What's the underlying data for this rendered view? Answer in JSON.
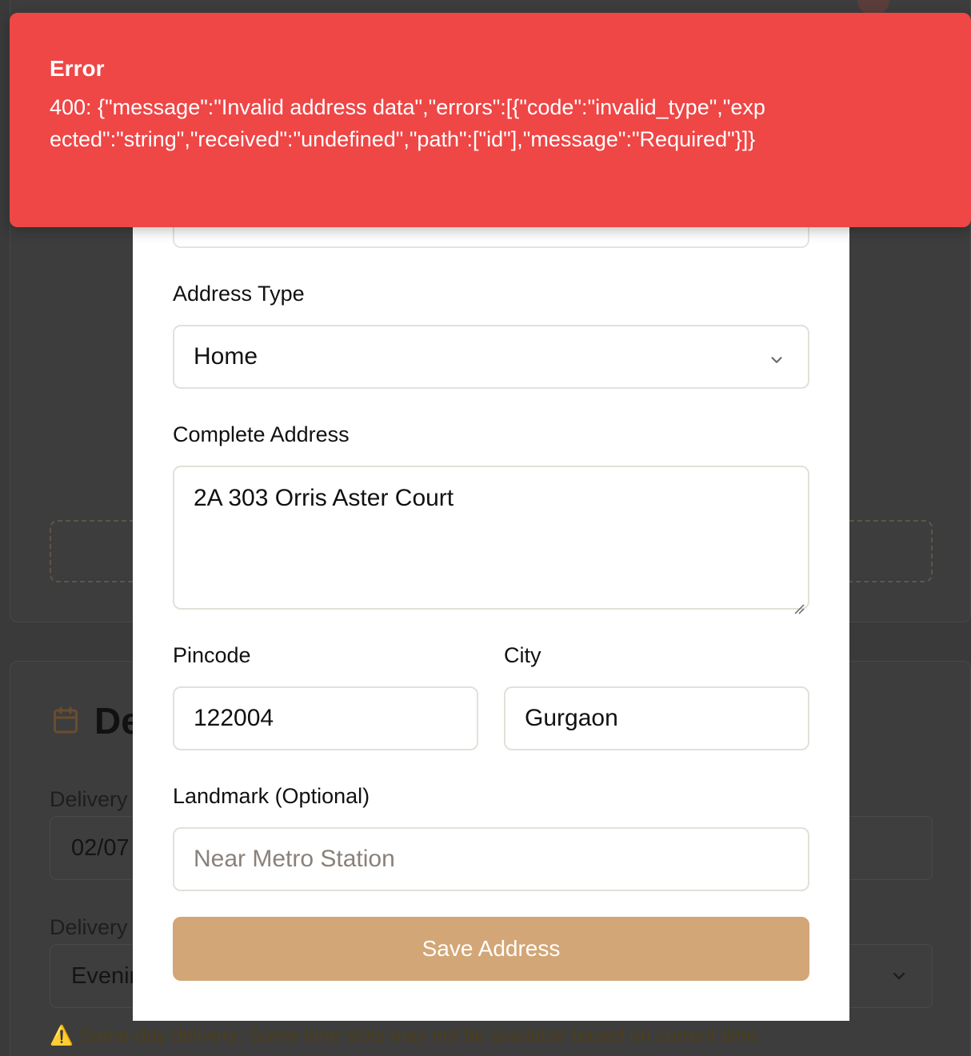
{
  "toast": {
    "title": "Error",
    "message": "400: {\"message\":\"Invalid address data\",\"errors\":[{\"code\":\"invalid_type\",\"expected\":\"string\",\"received\":\"undefined\",\"path\":[\"id\"],\"message\":\"Required\"}]}",
    "color": "#ef4646"
  },
  "modal": {
    "address_type": {
      "label": "Address Type",
      "value": "Home",
      "icon": "chevron-down-icon"
    },
    "complete_address": {
      "label": "Complete Address",
      "value": "2A 303 Orris Aster Court"
    },
    "pincode": {
      "label": "Pincode",
      "value": "122004"
    },
    "city": {
      "label": "City",
      "value": "Gurgaon"
    },
    "landmark": {
      "label": "Landmark (Optional)",
      "value": "",
      "placeholder": "Near Metro Station"
    },
    "save_button": {
      "label": "Save Address",
      "color": "#d2a676"
    }
  },
  "background": {
    "section_heading": "De",
    "delivery_date": {
      "label": "Delivery",
      "value": "02/07"
    },
    "delivery_time": {
      "label": "Delivery",
      "value": "Evenir"
    },
    "note": "⚠️ Same-day delivery: Some time slots may not be available based on current time"
  }
}
